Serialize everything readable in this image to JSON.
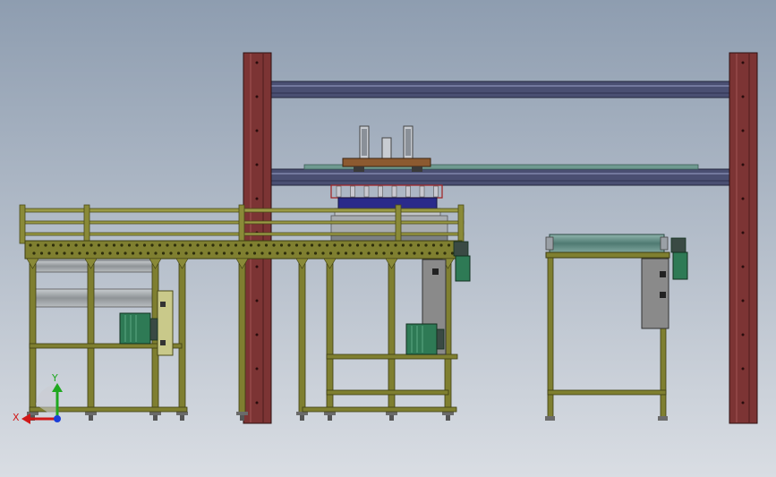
{
  "viewport": {
    "background_top": "#8e9db0",
    "background_bottom": "#d9dde3"
  },
  "triad": {
    "x_label": "X",
    "y_label": "Y",
    "x_color": "#d01818",
    "y_color": "#1fa81f",
    "z_color": "#1b3fd8"
  },
  "colors": {
    "frame": "#7f7f30",
    "frame_dark": "#4a4a18",
    "column": "#7c3434",
    "beam": "#4a4f72",
    "motor": "#2e7a55",
    "panel": "#8a8a8a",
    "roller": "#9ea3a6",
    "glass": "#5f8c84",
    "fixture": "#8c5a30",
    "press_plate": "#2a2a8a"
  }
}
